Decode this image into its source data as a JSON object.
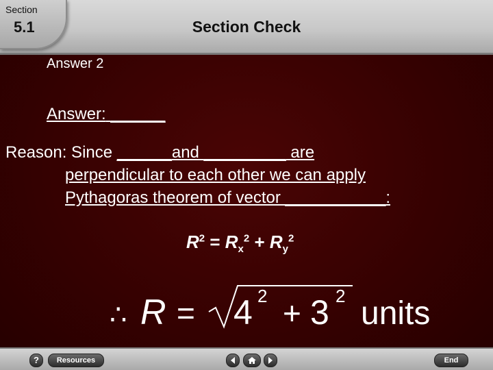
{
  "header": {
    "section_label": "Section",
    "section_number": "5.1",
    "title": "Section Check"
  },
  "content": {
    "answer_label": "Answer 2",
    "answer_prefix": "Answer:",
    "answer_blank": "______",
    "reason_line1_a": "Reason: Since ",
    "reason_line1_blank1": "______",
    "reason_line1_b": "and ",
    "reason_line1_blank2": "_________",
    "reason_line1_c": " are",
    "reason_line2": "perpendicular to each other we can apply",
    "reason_line3_a": "Pythagoras theorem of vector ",
    "reason_line3_blank": "___________",
    "reason_line3_c": ":",
    "formula_small": {
      "lhs": "R",
      "lhs_exp": "2",
      "eq": " = ",
      "t1": "R",
      "t1_sub": "x",
      "t1_exp": "2",
      "plus": " + ",
      "t2": "R",
      "t2_sub": "y",
      "t2_exp": "2"
    },
    "formula_big": {
      "therefore": "∴",
      "var": "R",
      "eq": "=",
      "a": "4",
      "a_exp": "2",
      "plus": "+",
      "b": "3",
      "b_exp": "2",
      "unit": "units"
    }
  },
  "nav": {
    "help": "?",
    "resources": "Resources",
    "end": "End"
  },
  "colors": {
    "background": "#3a0000",
    "header": "#c8c8c8",
    "text": "#ffffff"
  }
}
